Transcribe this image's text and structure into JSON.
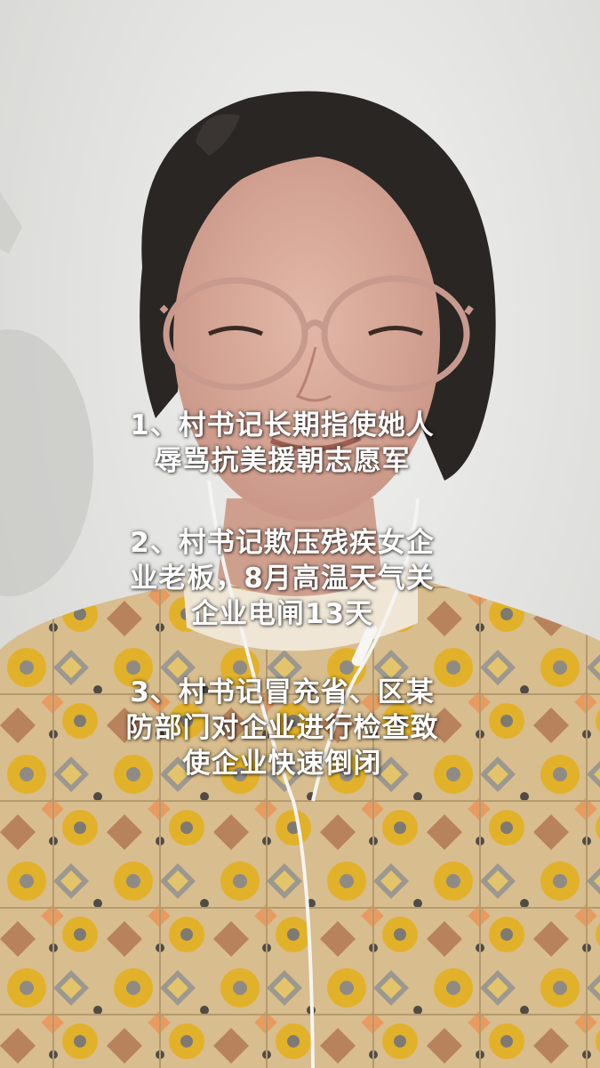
{
  "captions": [
    {
      "lines": [
        "1、村书记长期指使她人",
        "辱骂抗美援朝志愿军"
      ]
    },
    {
      "lines": [
        "2、村书记欺压残疾女企",
        "业老板，8月高温天气关",
        "企业电闸13天"
      ]
    },
    {
      "lines": [
        "3、村书记冒充省、区某",
        "防部门对企业进行检查致",
        "使企业快速倒闭"
      ]
    }
  ],
  "colors": {
    "wall": "#e6e6e4",
    "hair": "#2a2624",
    "skin": "#d7aa9a",
    "glasses": "#c89a8e",
    "collar": "#efe6d6",
    "shirt_base": "#d8b98a",
    "shirt_yellow": "#e3b528",
    "shirt_grey": "#8a8a86",
    "caption_text": "#ffffff"
  }
}
